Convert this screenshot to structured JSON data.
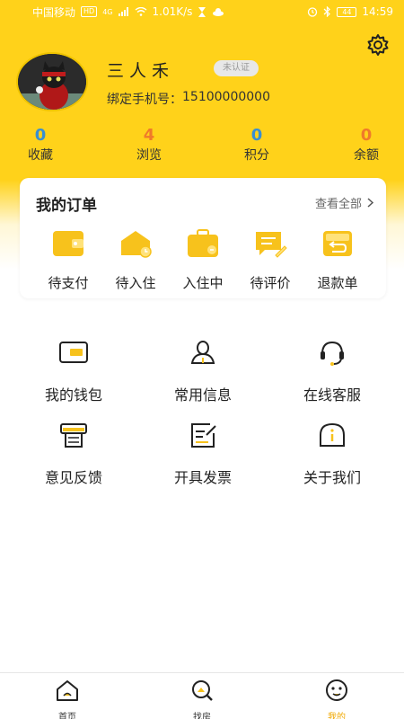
{
  "status_bar": {
    "carrier": "中国移动",
    "hd": "HD",
    "signal": "4G",
    "speed": "1.01K/s",
    "battery": "44",
    "time": "14:59"
  },
  "profile": {
    "name": "三人禾",
    "verify_badge": "未认证",
    "phone_label": "绑定手机号：",
    "phone": "15100000000"
  },
  "stats": [
    {
      "value": "0",
      "label": "收藏",
      "color": "#3a8fd0"
    },
    {
      "value": "4",
      "label": "浏览",
      "color": "#f07a2a"
    },
    {
      "value": "0",
      "label": "积分",
      "color": "#3a8fd0"
    },
    {
      "value": "0",
      "label": "余额",
      "color": "#f07a2a"
    }
  ],
  "orders": {
    "title": "我的订单",
    "view_all": "查看全部",
    "items": [
      {
        "label": "待支付",
        "icon": "wallet-icon"
      },
      {
        "label": "待入住",
        "icon": "envelope-clock-icon"
      },
      {
        "label": "入住中",
        "icon": "suitcase-icon"
      },
      {
        "label": "待评价",
        "icon": "comment-edit-icon"
      },
      {
        "label": "退款单",
        "icon": "refund-icon"
      }
    ]
  },
  "menu": [
    {
      "label": "我的钱包",
      "icon": "card-icon"
    },
    {
      "label": "常用信息",
      "icon": "user-icon"
    },
    {
      "label": "在线客服",
      "icon": "headset-icon"
    },
    {
      "label": "意见反馈",
      "icon": "printer-icon"
    },
    {
      "label": "开具发票",
      "icon": "invoice-edit-icon"
    },
    {
      "label": "关于我们",
      "icon": "info-icon"
    }
  ],
  "tabs": [
    {
      "label": "首页",
      "icon": "home-icon"
    },
    {
      "label": "找房",
      "icon": "search-home-icon"
    },
    {
      "label": "我的",
      "icon": "face-icon"
    }
  ],
  "colors": {
    "accent": "#ffd21a",
    "icon_yellow": "#f7c21c",
    "active_tab": "#f0a800"
  }
}
